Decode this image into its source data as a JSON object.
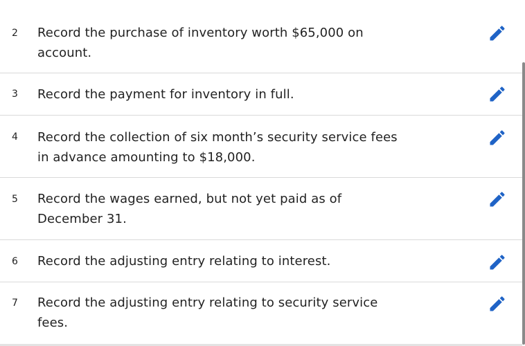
{
  "items": [
    {
      "number": "2",
      "line1": "Record the purchase of inventory worth $65,000 on",
      "line2": "account."
    },
    {
      "number": "3",
      "line1": "Record the payment for inventory in full.",
      "line2": ""
    },
    {
      "number": "4",
      "line1": "Record the collection of six month’s security service fees",
      "line2": "in advance amounting to $18,000."
    },
    {
      "number": "5",
      "line1": "Record the wages earned, but not yet paid as of",
      "line2": "December 31."
    },
    {
      "number": "6",
      "line1": "Record the adjusting entry relating to interest.",
      "line2": ""
    },
    {
      "number": "7",
      "line1": "Record the adjusting entry relating to security service",
      "line2": "fees."
    }
  ],
  "icons": {
    "edit": "pencil-icon"
  },
  "colors": {
    "accent": "#1f63c6",
    "divider": "#d9d9d9",
    "text": "#222222"
  }
}
